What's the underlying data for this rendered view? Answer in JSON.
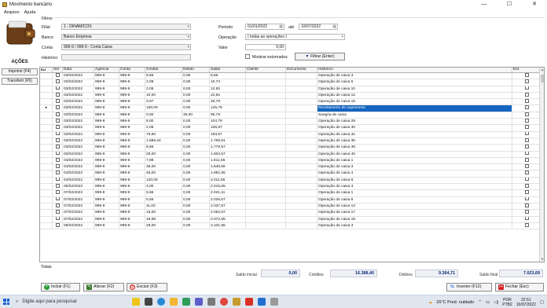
{
  "window": {
    "title": "Movimento bancário",
    "min_glyph": "—",
    "max_glyph": "☐",
    "close_glyph": "✕"
  },
  "menu": [
    "Arquivo",
    "Ajuda"
  ],
  "sidebar": {
    "title": "AÇÕES",
    "buttons": [
      {
        "label": "Imprimir (F4)"
      },
      {
        "label": "Transferir (F5)"
      }
    ]
  },
  "filters": {
    "legend": "Filtros",
    "filial_label": "Filial",
    "filial_value": "1 - DINAMICOS",
    "banco_label": "Banco",
    "banco_value": "Banco Empresa",
    "conta_label": "Conta",
    "conta_value": "999-9 / 999-9 - Conta Caixa",
    "historico_label": "Histórico",
    "historico_value": "",
    "periodo_label": "Período",
    "periodo_from": "01/01/2022",
    "periodo_ate": "até",
    "periodo_to": "10/07/2022",
    "operacao_label": "Operação",
    "operacao_value": "( todas as operações )",
    "valor_label": "Valor",
    "valor_value": "0,00",
    "mostrar_estornados": "Mostrar estornados",
    "filter_button": "Filtrar (Enter)"
  },
  "grid": {
    "columns": [
      "Est",
      "Sel",
      "Data",
      "Agencia",
      "Conta",
      "Crédito",
      "Débito",
      "Saldo",
      "Cliente",
      "Documento",
      "Histórico",
      "Est."
    ],
    "selected_row": 6,
    "rows": [
      [
        "03/02/2022",
        "999-9",
        "999-9",
        "8,66",
        "0,00",
        "8,66",
        "Operação de caixa 3"
      ],
      [
        "03/02/2022",
        "999-9",
        "999-9",
        "2,08",
        "0,00",
        "10,74",
        "Operação de caixa 6"
      ],
      [
        "03/02/2022",
        "999-9",
        "999-9",
        "2,08",
        "0,00",
        "12,82",
        "Operação de caixa 10"
      ],
      [
        "03/02/2022",
        "999-9",
        "999-9",
        "10,00",
        "0,00",
        "22,82",
        "Operação de caixa 12"
      ],
      [
        "03/02/2022",
        "999-9",
        "999-9",
        "3,97",
        "0,00",
        "26,79",
        "Operação de caixa 16"
      ],
      [
        "03/02/2022",
        "999-9",
        "999-9",
        "100,00",
        "0,00",
        "126,79",
        "Recebimento de suprimento"
      ],
      [
        "03/02/2022",
        "999-9",
        "999-9",
        "0,00",
        "30,00",
        "96,79",
        "Sangria de caixa"
      ],
      [
        "03/02/2022",
        "999-9",
        "999-9",
        "8,00",
        "0,00",
        "104,79",
        "Operação de caixa 29"
      ],
      [
        "03/02/2022",
        "999-9",
        "999-9",
        "2,08",
        "0,00",
        "106,87",
        "Operação de caixa 30"
      ],
      [
        "03/02/2022",
        "999-9",
        "999-9",
        "76,80",
        "0,00",
        "183,67",
        "Operação de caixa 31"
      ],
      [
        "03/02/2022",
        "999-9",
        "999-9",
        "1.586,24",
        "0,00",
        "1.769,91",
        "Operação de caixa 36"
      ],
      [
        "03/02/2022",
        "999-9",
        "999-9",
        "8,66",
        "0,00",
        "1.778,57",
        "Operação de caixa 39"
      ],
      [
        "03/02/2022",
        "999-9",
        "999-9",
        "25,00",
        "0,00",
        "1.803,57",
        "Operação de caixa 40"
      ],
      [
        "04/02/2022",
        "999-9",
        "999-9",
        "7,98",
        "0,00",
        "1.811,55",
        "Operação de caixa 1"
      ],
      [
        "04/02/2022",
        "999-9",
        "999-9",
        "35,00",
        "0,00",
        "1.846,55",
        "Operação de caixa 3"
      ],
      [
        "04/02/2022",
        "999-9",
        "999-9",
        "45,00",
        "0,00",
        "1.891,55",
        "Operação de caixa 4"
      ],
      [
        "04/02/2022",
        "999-9",
        "999-9",
        "120,00",
        "0,00",
        "2.011,55",
        "Operação de caixa 6"
      ],
      [
        "05/02/2022",
        "999-9",
        "999-9",
        "4,00",
        "0,00",
        "2.015,55",
        "Operação de caixa 3"
      ],
      [
        "07/02/2022",
        "999-9",
        "999-9",
        "5,56",
        "0,00",
        "2.021,11",
        "Operação de caixa 1"
      ],
      [
        "07/02/2022",
        "999-9",
        "999-9",
        "5,56",
        "0,00",
        "2.026,67",
        "Operação de caixa 6"
      ],
      [
        "07/02/2022",
        "999-9",
        "999-9",
        "11,00",
        "0,00",
        "2.037,67",
        "Operação de caixa 13"
      ],
      [
        "07/02/2022",
        "999-9",
        "999-9",
        "15,00",
        "0,00",
        "2.052,67",
        "Operação de caixa 17"
      ],
      [
        "07/02/2022",
        "999-9",
        "999-9",
        "19,88",
        "0,00",
        "2.072,55",
        "Operação de caixa 19"
      ],
      [
        "08/02/2022",
        "999-9",
        "999-9",
        "29,00",
        "0,00",
        "2.101,55",
        "Operação de caixa 3"
      ]
    ]
  },
  "totals": {
    "label": "Totais",
    "saldo_inicial_label": "Saldo inicial",
    "saldo_inicial": "0,00",
    "creditos_label": "Créditos",
    "creditos": "16.388,40",
    "debitos_label": "Débitos",
    "debitos": "9.364,71",
    "saldo_final_label": "Saldo final",
    "saldo_final": "7.023,69"
  },
  "buttons": {
    "incluir": "Incluir (F1)",
    "alterar": "Alterar (F2)",
    "excluir": "Excluir (F3)",
    "inverter": "Inverter (F12)",
    "fechar": "Fechar (Esc)"
  },
  "taskbar": {
    "search_placeholder": "Digite aqui para pesquisar",
    "weather": "26°C  Pred. nublado",
    "lang_top": "POR",
    "lang_bottom": "PTB2",
    "time": "22:51",
    "date": "10/07/2022"
  },
  "colors": {
    "selection": "#1565c0",
    "totals_text": "#0d2c7a"
  }
}
